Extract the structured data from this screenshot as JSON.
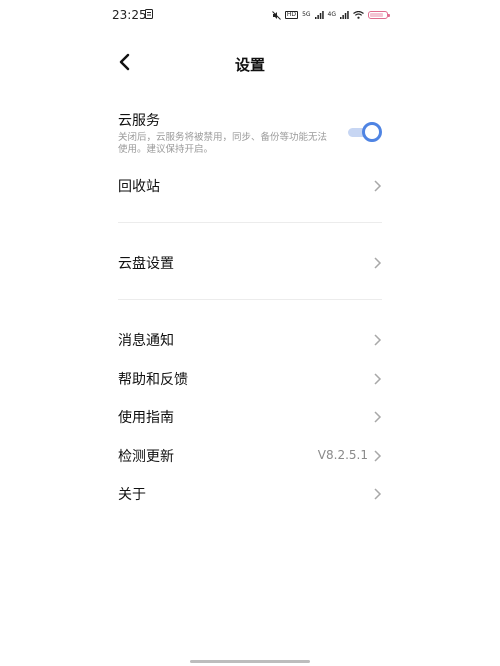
{
  "status_bar": {
    "time": "23:25",
    "net1": "5G",
    "net2": "4G",
    "hd": "HD"
  },
  "header": {
    "title": "设置"
  },
  "settings": {
    "cloud_service": {
      "label": "云服务",
      "description": "关闭后，云服务将被禁用，同步、备份等功能无法使用。建议保持开启。",
      "enabled": true
    },
    "recycle_bin": {
      "label": "回收站"
    },
    "cloud_disk_settings": {
      "label": "云盘设置"
    },
    "notifications": {
      "label": "消息通知"
    },
    "help_feedback": {
      "label": "帮助和反馈"
    },
    "user_guide": {
      "label": "使用指南"
    },
    "check_update": {
      "label": "检测更新",
      "version": "V8.2.5.1"
    },
    "about": {
      "label": "关于"
    }
  },
  "colors": {
    "accent": "#4f84e3",
    "track": "#c7d6f3",
    "battery": "#e06d8f"
  }
}
